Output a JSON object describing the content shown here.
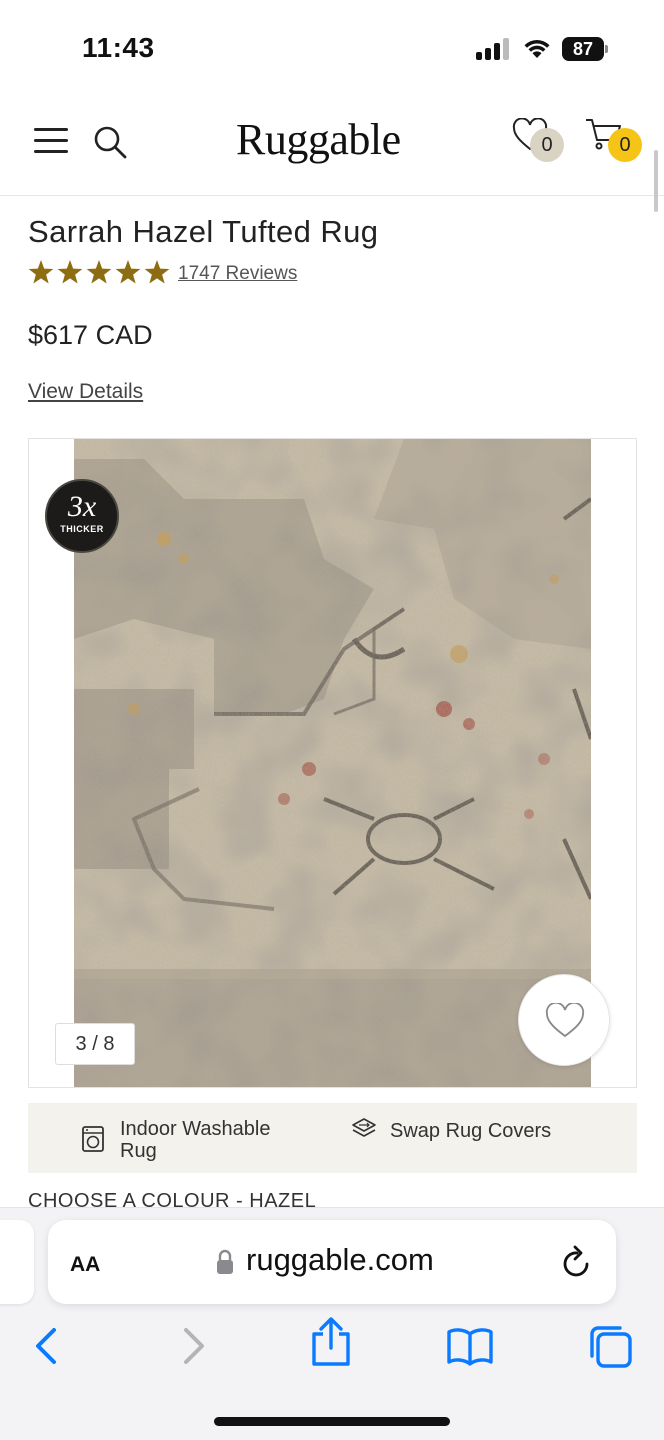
{
  "status_bar": {
    "time": "11:43",
    "battery": "87",
    "icons": [
      "signal-icon",
      "wifi-icon",
      "battery-icon"
    ]
  },
  "header": {
    "logo": "Ruggable",
    "wishlist_count": "0",
    "cart_count": "0",
    "icons": [
      "menu-icon",
      "search-icon",
      "heart-icon",
      "cart-icon"
    ],
    "colors": {
      "cart_badge": "#f6c417",
      "wishlist_badge": "#d9d3c4"
    }
  },
  "product": {
    "title": "Sarrah Hazel Tufted Rug",
    "rating": 5,
    "rating_max": 5,
    "reviews": "1747 Reviews",
    "price": "$617 CAD",
    "view_details": "View Details",
    "colors": {
      "star": "#8e6d12"
    }
  },
  "carousel": {
    "badge_big": "3x",
    "badge_small": "THICKER",
    "counter": "3 / 8",
    "icons": [
      "heart-outline-icon"
    ]
  },
  "features": [
    {
      "label": "Indoor Washable Rug",
      "icon": "washing-machine-icon"
    },
    {
      "label": "Swap Rug Covers",
      "icon": "layers-swap-icon"
    }
  ],
  "colour_heading": "CHOOSE A COLOUR - HAZEL",
  "browser": {
    "aa_label": "AA",
    "url": "ruggable.com",
    "icons": [
      "lock-icon",
      "reload-icon",
      "back-icon",
      "forward-icon",
      "share-icon",
      "bookmarks-icon",
      "tabs-icon"
    ],
    "colors": {
      "accent": "#0a7aff"
    }
  }
}
